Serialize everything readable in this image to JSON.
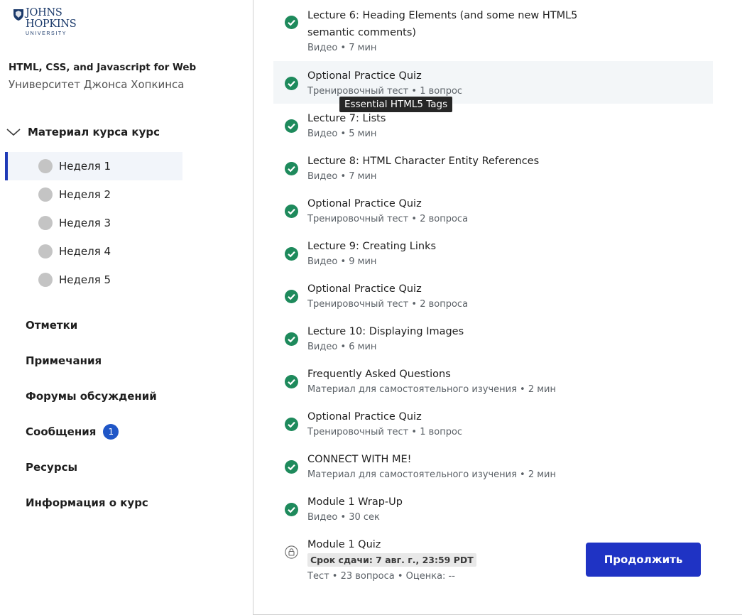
{
  "logo": {
    "line1": "JOHNS",
    "line2": "HOPKINS",
    "line3": "UNIVERSITY"
  },
  "course": {
    "title": "HTML, CSS, and Javascript for Web Developers",
    "org": "Университет Джонса Хопкинса"
  },
  "sidebar": {
    "section_label": "Материал курса курс",
    "weeks": [
      {
        "label": "Неделя 1"
      },
      {
        "label": "Неделя 2"
      },
      {
        "label": "Неделя 3"
      },
      {
        "label": "Неделя 4"
      },
      {
        "label": "Неделя 5"
      }
    ],
    "links": [
      {
        "label": "Отметки"
      },
      {
        "label": "Примечания"
      },
      {
        "label": "Форумы обсуждений"
      },
      {
        "label": "Сообщения",
        "badge": "1"
      },
      {
        "label": "Ресурсы"
      },
      {
        "label": "Информация о курс"
      }
    ]
  },
  "items": [
    {
      "title": "Lecture 6: Heading Elements (and some new HTML5 semantic comments)",
      "meta": "Видео • 7 мин"
    },
    {
      "title": "Optional Practice Quiz",
      "meta": "Тренировочный тест • 1 вопрос"
    },
    {
      "title": "Lecture 7: Lists",
      "meta": "Видео • 5 мин"
    },
    {
      "title": "Lecture 8: HTML Character Entity References",
      "meta": "Видео • 7 мин"
    },
    {
      "title": "Optional Practice Quiz",
      "meta": "Тренировочный тест • 2 вопроса"
    },
    {
      "title": "Lecture 9: Creating Links",
      "meta": "Видео • 9 мин"
    },
    {
      "title": "Optional Practice Quiz",
      "meta": "Тренировочный тест • 2 вопроса"
    },
    {
      "title": "Lecture 10: Displaying Images",
      "meta": "Видео • 6 мин"
    },
    {
      "title": "Frequently Asked Questions",
      "meta": "Материал для самостоятельного изучения • 2 мин"
    },
    {
      "title": "Optional Practice Quiz",
      "meta": "Тренировочный тест • 1 вопрос"
    },
    {
      "title": "CONNECT WITH ME!",
      "meta": "Материал для самостоятельного изучения • 2 мин"
    },
    {
      "title": "Module 1 Wrap-Up",
      "meta": "Видео • 30 сек"
    },
    {
      "title": "Module 1 Quiz",
      "deadline": "Срок сдачи: 7 авг. г., 23:59 PDT",
      "meta": "Тест • 23 вопроса • Оценка: --"
    }
  ],
  "tooltip": "Essential HTML5 Tags",
  "continue_label": "Продолжить",
  "colors": {
    "accent": "#1f33c4",
    "check": "#1e8a5c",
    "badge": "#1f56c7"
  }
}
